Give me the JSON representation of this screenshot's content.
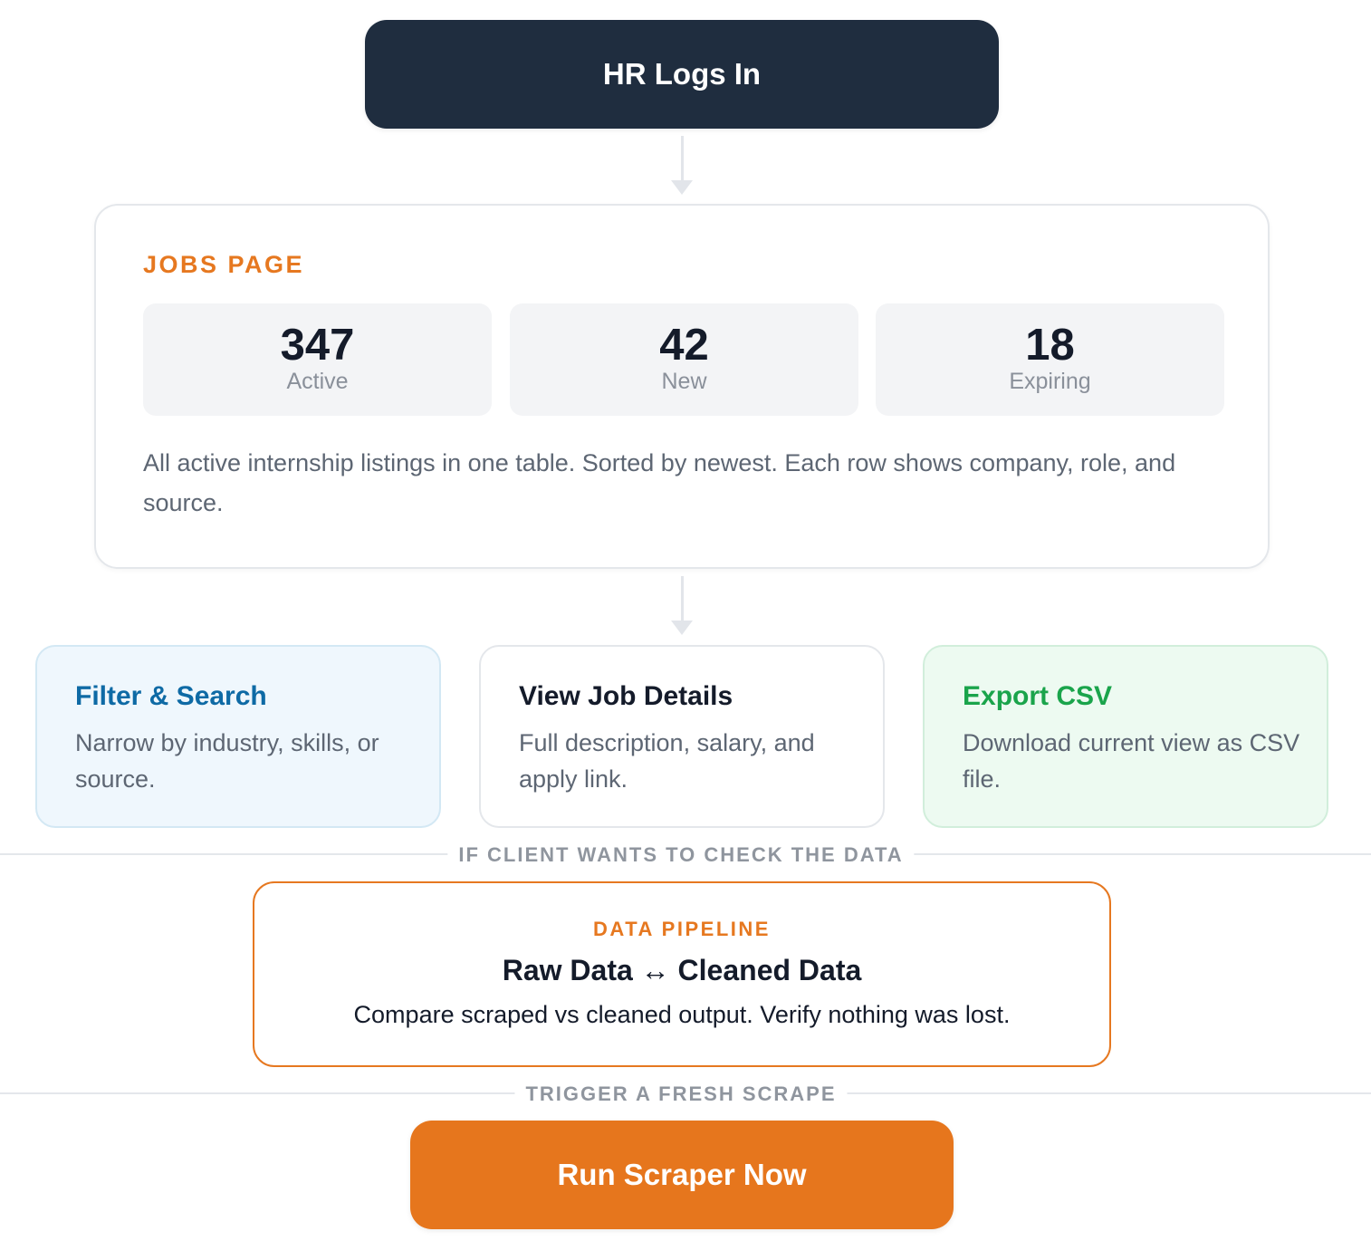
{
  "login": {
    "label": "HR Logs In"
  },
  "jobs_page": {
    "title": "JOBS PAGE",
    "stats": [
      {
        "value": "347",
        "label": "Active"
      },
      {
        "value": "42",
        "label": "New"
      },
      {
        "value": "18",
        "label": "Expiring"
      }
    ],
    "description": "All active internship listings in one table. Sorted by newest. Each row shows company, role, and source."
  },
  "actions": [
    {
      "title": "Filter & Search",
      "description": "Narrow by industry, skills, or source.",
      "accent": "#0e6aa5"
    },
    {
      "title": "View Job Details",
      "description": "Full description, salary, and apply link.",
      "accent": "#141b2a"
    },
    {
      "title": "Export CSV",
      "description": "Download current view as CSV file.",
      "accent": "#1aa44b"
    }
  ],
  "separators": {
    "check_data": "IF CLIENT WANTS TO CHECK THE DATA",
    "fresh_scrape": "TRIGGER A FRESH SCRAPE"
  },
  "pipeline": {
    "kicker": "DATA PIPELINE",
    "title": "Raw Data ↔ Cleaned Data",
    "description": "Compare scraped vs cleaned output. Verify nothing was lost."
  },
  "run_button": {
    "label": "Run Scraper Now"
  },
  "colors": {
    "navy": "#1f2d3f",
    "orange": "#e67820",
    "blue": "#0e6aa5",
    "green": "#1aa44b"
  }
}
